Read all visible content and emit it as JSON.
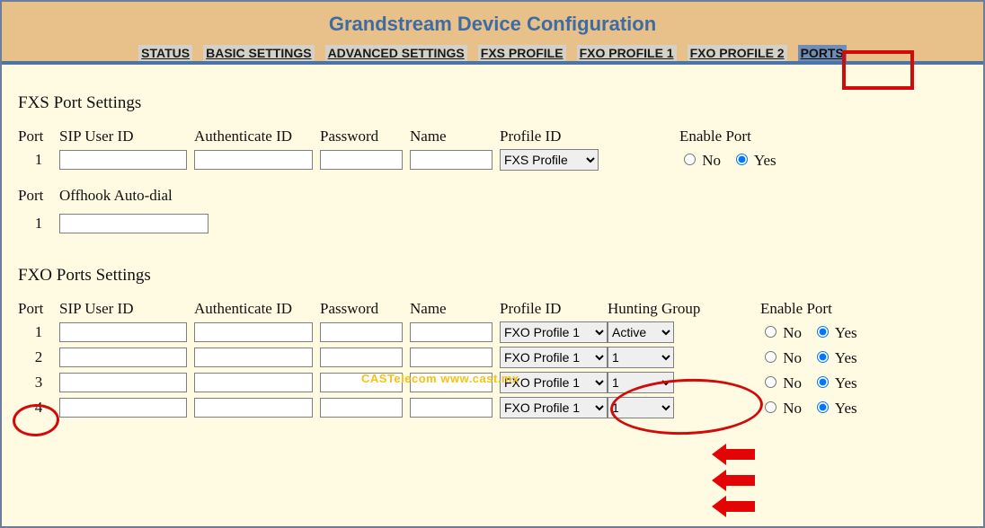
{
  "header": {
    "title": "Grandstream Device Configuration",
    "tabs": {
      "status": "STATUS",
      "basic": "BASIC SETTINGS",
      "advanced": "ADVANCED SETTINGS",
      "fxs_profile": "FXS PROFILE",
      "fxo_profile_1": "FXO PROFILE 1",
      "fxo_profile_2": "FXO PROFILE 2",
      "ports": "PORTS"
    }
  },
  "fxs": {
    "section_title": "FXS Port Settings",
    "headers": {
      "port": "Port",
      "sip": "SIP User ID",
      "auth": "Authenticate ID",
      "password": "Password",
      "name": "Name",
      "profile": "Profile ID",
      "enable": "Enable Port"
    },
    "port_num": "1",
    "profile_value": "FXS Profile",
    "enable_no": "No",
    "enable_yes": "Yes",
    "offhook_header_port": "Port",
    "offhook_header_label": "Offhook Auto-dial",
    "offhook_port_num": "1"
  },
  "fxo": {
    "section_title": "FXO Ports Settings",
    "headers": {
      "port": "Port",
      "sip": "SIP User ID",
      "auth": "Authenticate ID",
      "password": "Password",
      "name": "Name",
      "profile": "Profile ID",
      "hunting": "Hunting Group",
      "enable": "Enable Port"
    },
    "rows": [
      {
        "num": "1",
        "profile": "FXO Profile 1",
        "hunt": "Active"
      },
      {
        "num": "2",
        "profile": "FXO Profile 1",
        "hunt": "1"
      },
      {
        "num": "3",
        "profile": "FXO Profile 1",
        "hunt": "1"
      },
      {
        "num": "4",
        "profile": "FXO Profile 1",
        "hunt": "1"
      }
    ],
    "enable_no": "No",
    "enable_yes": "Yes"
  },
  "watermark": "CASTelecom    www.cast.mx"
}
